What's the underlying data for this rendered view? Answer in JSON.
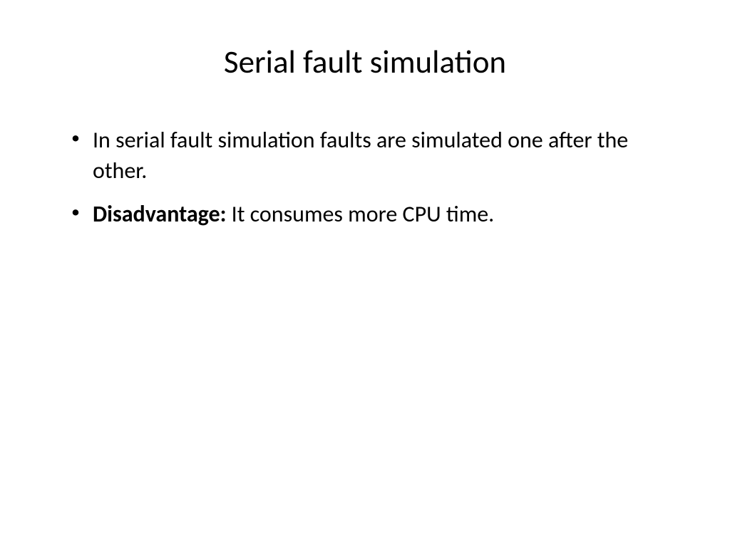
{
  "slide": {
    "title": "Serial fault simulation",
    "bullets": [
      {
        "text": "In serial fault simulation faults are simulated one after the other."
      },
      {
        "prefix_bold": "Disadvantage:",
        "text": " It consumes more CPU time."
      }
    ]
  }
}
